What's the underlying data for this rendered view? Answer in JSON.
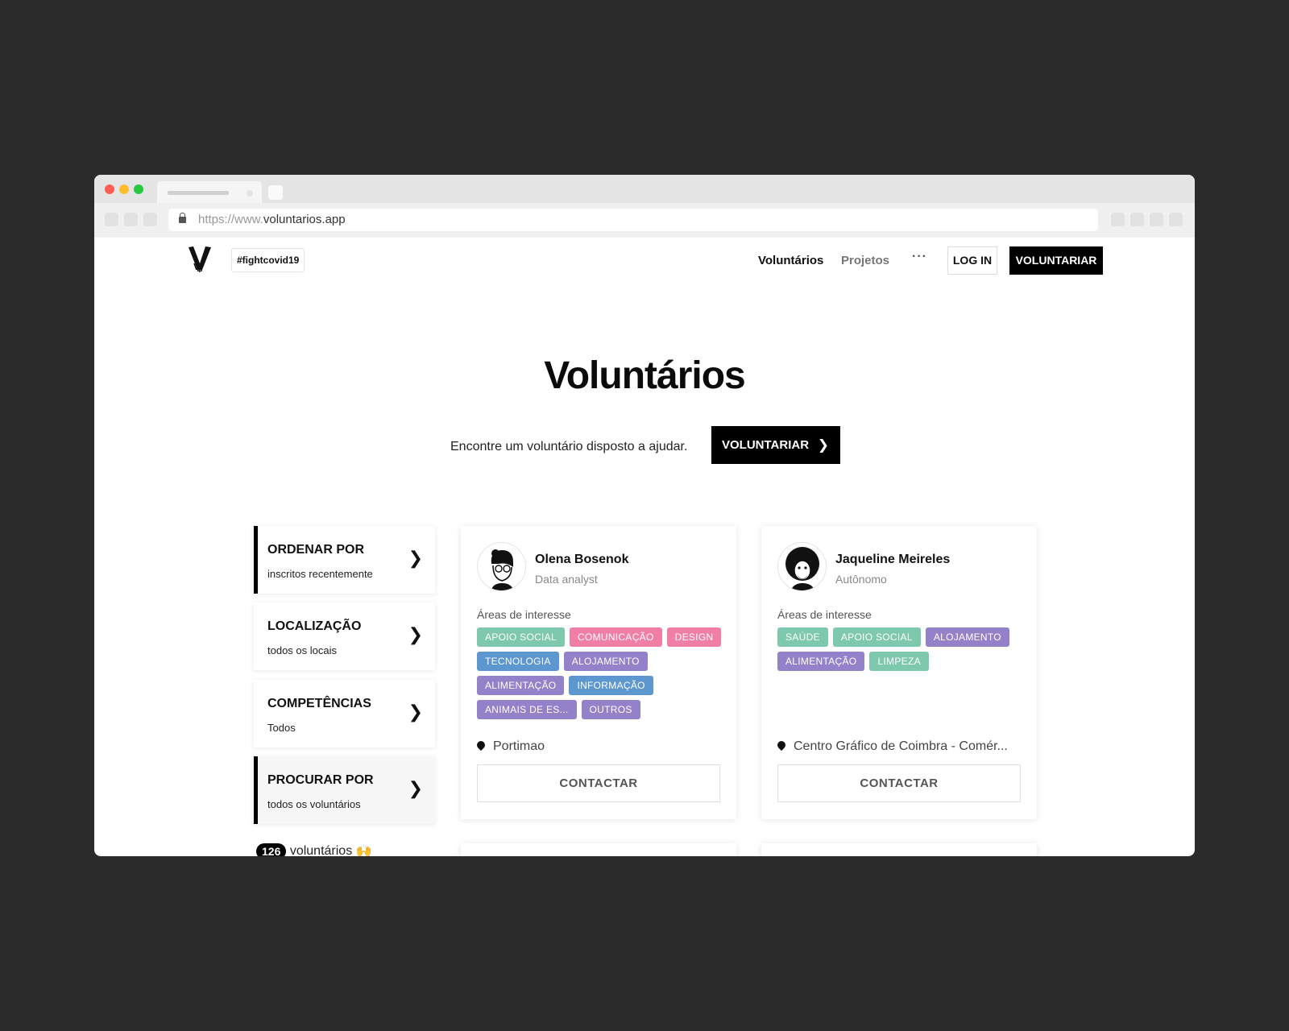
{
  "browser": {
    "url_prefix": "https://www.",
    "url_domain": "voluntarios.app"
  },
  "header": {
    "hashtag": "#fightcovid19",
    "nav_voluntarios": "Voluntários",
    "nav_projetos": "Projetos",
    "nav_more": "···",
    "login": "LOG IN",
    "voluntariar": "VOLUNTARIAR"
  },
  "hero": {
    "title": "Voluntários",
    "text": "Encontre um voluntário disposto a ajudar.",
    "button": "VOLUNTARIAR",
    "button_icon": "chevron-right-icon"
  },
  "filters": [
    {
      "title": "ORDENAR POR",
      "value": "inscritos recentemente"
    },
    {
      "title": "LOCALIZAÇÃO",
      "value": "todos os locais"
    },
    {
      "title": "COMPETÊNCIAS",
      "value": "Todos"
    },
    {
      "title": "PROCURAR POR",
      "value": "todos os voluntários"
    }
  ],
  "count": {
    "number": "126",
    "label": "voluntários",
    "emoji": "🙌"
  },
  "areas_label": "Áreas de interesse",
  "contact_label": "CONTACTAR",
  "tag_colors": {
    "green": "#7ec8ad",
    "pink": "#f17ea4",
    "blue": "#5d97cf",
    "purple": "#9382c9"
  },
  "volunteers": [
    {
      "name": "Olena Bosenok",
      "role": "Data analyst",
      "location": "Portimao",
      "tags": [
        {
          "label": "APOIO SOCIAL",
          "color": "green"
        },
        {
          "label": "COMUNICAÇÃO",
          "color": "pink"
        },
        {
          "label": "DESIGN",
          "color": "pink"
        },
        {
          "label": "TECNOLOGIA",
          "color": "blue"
        },
        {
          "label": "ALOJAMENTO",
          "color": "purple"
        },
        {
          "label": "ALIMENTAÇÃO",
          "color": "purple"
        },
        {
          "label": "INFORMAÇÃO",
          "color": "blue"
        },
        {
          "label": "ANIMAIS DE ES...",
          "color": "purple"
        },
        {
          "label": "OUTROS",
          "color": "purple"
        }
      ]
    },
    {
      "name": "Jaqueline Meireles",
      "role": "Autônomo",
      "location": "Centro Gráfico de Coimbra - Comér...",
      "tags": [
        {
          "label": "SAÚDE",
          "color": "green"
        },
        {
          "label": "APOIO SOCIAL",
          "color": "green"
        },
        {
          "label": "ALOJAMENTO",
          "color": "purple"
        },
        {
          "label": "ALIMENTAÇÃO",
          "color": "purple"
        },
        {
          "label": "LIMPEZA",
          "color": "green"
        }
      ]
    }
  ]
}
